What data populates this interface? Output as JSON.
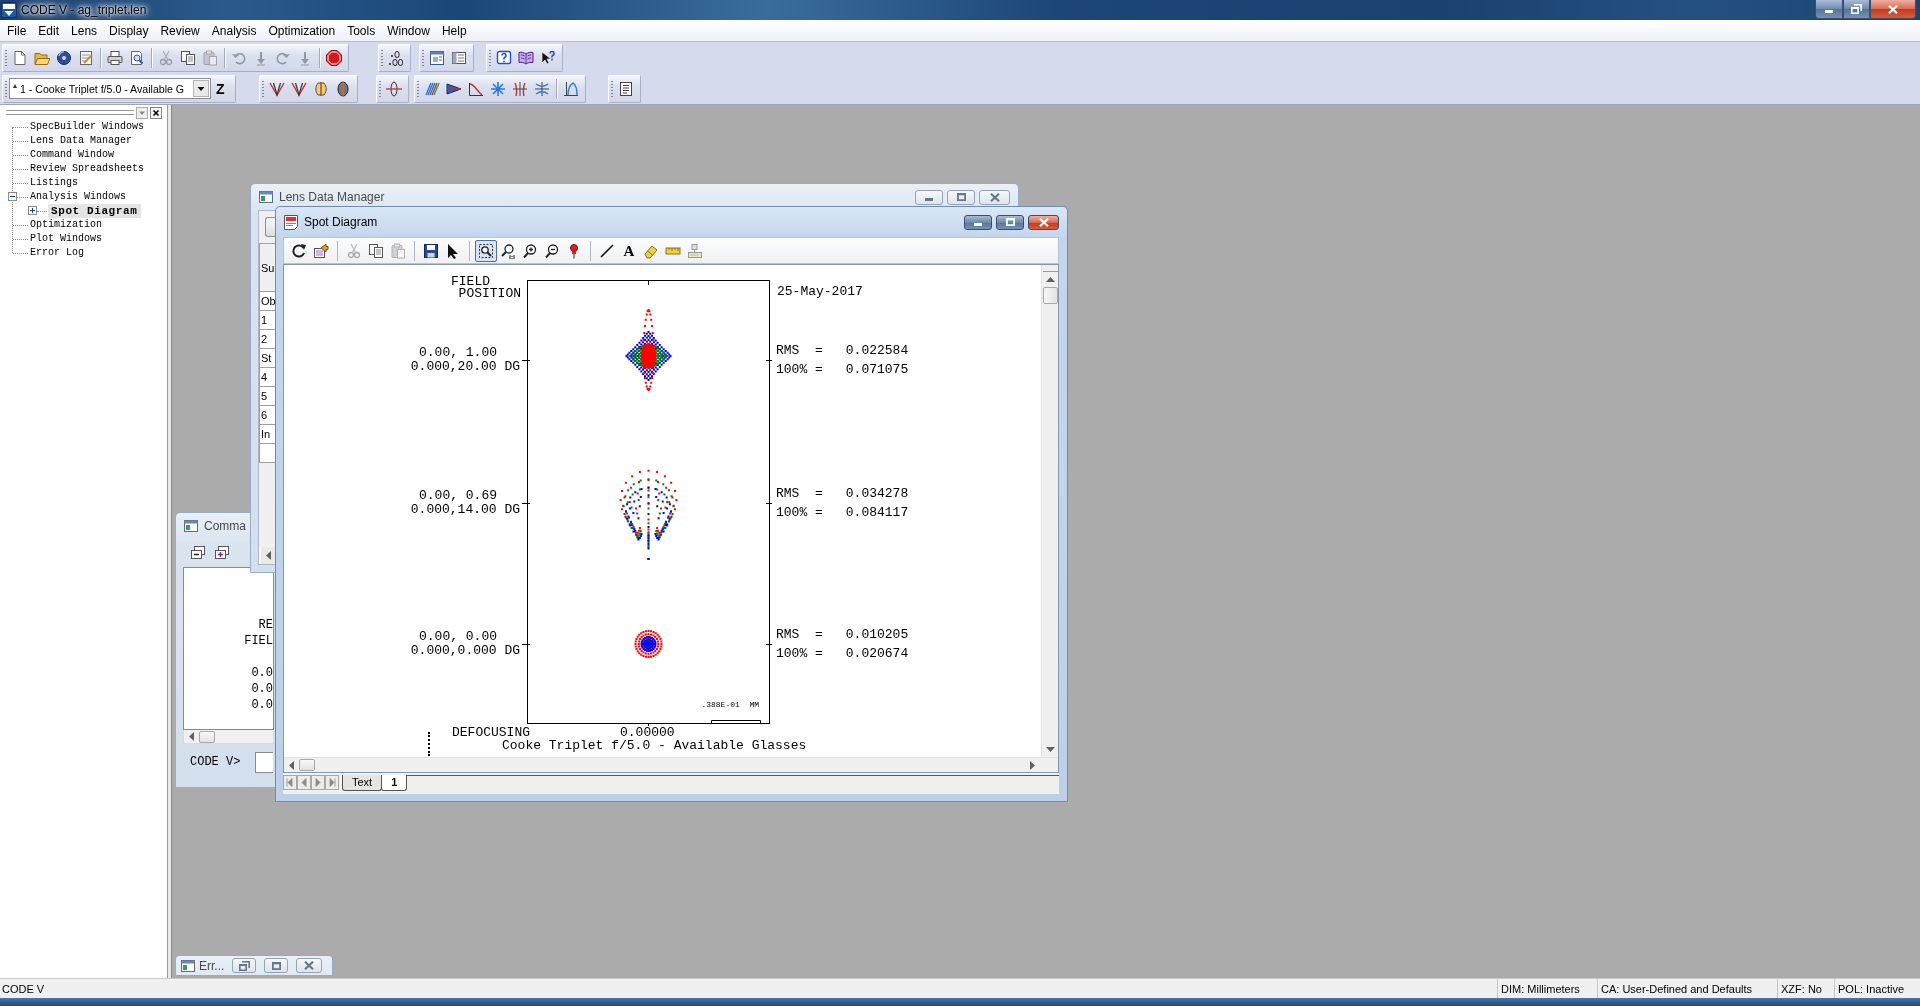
{
  "window": {
    "title": "CODE V - ag_triplet.len"
  },
  "menu": [
    "File",
    "Edit",
    "Lens",
    "Display",
    "Review",
    "Analysis",
    "Optimization",
    "Tools",
    "Window",
    "Help"
  ],
  "toolbar_1": {
    "bands": [
      [
        [
          {
            "kind": "new",
            "disabled": false
          },
          {
            "kind": "open",
            "disabled": false
          },
          {
            "kind": "disc",
            "disabled": false
          },
          {
            "kind": "edit",
            "disabled": false
          }
        ],
        [
          {
            "kind": "print",
            "disabled": false
          },
          {
            "kind": "preview",
            "disabled": false
          }
        ],
        [
          {
            "kind": "cut",
            "disabled": true
          },
          {
            "kind": "copy",
            "disabled": false
          },
          {
            "kind": "paste",
            "disabled": true
          }
        ],
        [
          {
            "kind": "undo",
            "disabled": true
          },
          {
            "kind": "down",
            "disabled": true
          },
          {
            "kind": "redo",
            "disabled": true
          },
          {
            "kind": "down",
            "disabled": true
          }
        ],
        [
          {
            "kind": "stop",
            "disabled": false
          }
        ]
      ],
      [
        [
          {
            "kind": "decimal",
            "disabled": false
          }
        ]
      ],
      [
        [
          {
            "kind": "chartwin",
            "disabled": false
          },
          {
            "kind": "panelwin",
            "disabled": false
          }
        ]
      ],
      [
        [
          {
            "kind": "help",
            "disabled": false
          },
          {
            "kind": "book",
            "disabled": false
          },
          {
            "kind": "whatsthis",
            "disabled": false
          }
        ]
      ]
    ]
  },
  "toolbar_2": {
    "lens_selector": {
      "value": "1 - Cooke Triplet f/5.0 - Available G"
    },
    "z_button": {
      "label": "Z"
    },
    "bands": [
      [
        [
          {
            "kind": "fan",
            "disabled": false
          },
          {
            "kind": "fan",
            "disabled": false
          },
          {
            "kind": "lens",
            "disabled": false
          },
          {
            "kind": "darklens",
            "disabled": false
          }
        ]
      ],
      [
        [
          {
            "kind": "axis",
            "disabled": false
          }
        ]
      ],
      [
        [
          {
            "kind": "trace",
            "disabled": false
          },
          {
            "kind": "bundle",
            "disabled": false
          },
          {
            "kind": "mtf",
            "disabled": false
          },
          {
            "kind": "star",
            "disabled": false
          },
          {
            "kind": "fieldcurve",
            "disabled": false
          },
          {
            "kind": "distortion",
            "disabled": false
          }
        ],
        [
          {
            "kind": "peak",
            "disabled": false
          }
        ]
      ],
      [
        [
          {
            "kind": "listing",
            "disabled": false
          }
        ]
      ]
    ]
  },
  "navigator": {
    "items": [
      {
        "label": "SpecBuilder Windows",
        "selected": false
      },
      {
        "label": "Lens Data Manager",
        "selected": false
      },
      {
        "label": "Command Window",
        "selected": false
      },
      {
        "label": "Review Spreadsheets",
        "selected": false
      },
      {
        "label": "Listings",
        "selected": false
      },
      {
        "label": "Analysis Windows",
        "selected": false,
        "expanded": true,
        "children": [
          {
            "label": "Spot Diagram",
            "selected": true,
            "expanded": false
          }
        ]
      },
      {
        "label": "Optimization",
        "selected": false
      },
      {
        "label": "Plot Windows",
        "selected": false
      },
      {
        "label": "Error Log",
        "selected": false
      }
    ]
  },
  "lens_data_manager": {
    "title": "Lens Data Manager",
    "header": "Su",
    "rows": [
      "Ob",
      "1",
      "2",
      "St",
      "4",
      "5",
      "6",
      "In"
    ]
  },
  "command_window": {
    "title": "Comma",
    "output": [
      [
        "RE",
        "FIEL"
      ],
      [
        "0.0",
        "0.0",
        "0.0"
      ]
    ],
    "prompt": "CODE V>"
  },
  "spot_diagram": {
    "title": "Spot Diagram",
    "toolbar": [
      [
        {
          "kind": "refresh",
          "disabled": false,
          "pressed": false
        },
        {
          "kind": "export",
          "disabled": false,
          "pressed": false
        }
      ],
      [
        {
          "kind": "cut",
          "disabled": true,
          "pressed": false
        },
        {
          "kind": "copy",
          "disabled": false,
          "pressed": false
        },
        {
          "kind": "paste",
          "disabled": true,
          "pressed": false
        }
      ],
      [
        {
          "kind": "save",
          "disabled": false,
          "pressed": false
        },
        {
          "kind": "pointer",
          "disabled": false,
          "pressed": false
        }
      ],
      [
        {
          "kind": "zoombox",
          "disabled": false,
          "pressed": true
        },
        {
          "kind": "zoom11",
          "disabled": false,
          "pressed": false
        },
        {
          "kind": "zoomin",
          "disabled": false,
          "pressed": false
        },
        {
          "kind": "zoomout",
          "disabled": false,
          "pressed": false
        },
        {
          "kind": "pin",
          "disabled": false,
          "pressed": false
        }
      ],
      [
        {
          "kind": "line",
          "disabled": false,
          "pressed": false
        },
        {
          "kind": "text",
          "label": "A",
          "disabled": false,
          "pressed": false
        },
        {
          "kind": "eraser",
          "disabled": false,
          "pressed": false
        },
        {
          "kind": "ruler",
          "disabled": false,
          "pressed": false
        },
        {
          "kind": "labeltool",
          "disabled": false,
          "pressed": false
        }
      ]
    ],
    "field_heading": [
      "FIELD",
      "POSITION"
    ],
    "date": "25-May-2017",
    "fields": [
      {
        "kind": "diamond",
        "relative": "0.00, 1.00",
        "angle": "0.000,20.00 DG",
        "rms_label": "RMS  =",
        "rms": "0.022584",
        "max_label": "100% =",
        "max": "0.071075"
      },
      {
        "kind": "fan",
        "relative": "0.00, 0.69",
        "angle": "0.000,14.00 DG",
        "rms_label": "RMS  =",
        "rms": "0.034278",
        "max_label": "100% =",
        "max": "0.084117"
      },
      {
        "kind": "disc",
        "relative": "0.00, 0.00",
        "angle": "0.000,0.000 DG",
        "rms_label": "RMS  =",
        "rms": "0.010205",
        "max_label": "100% =",
        "max": "0.020674"
      }
    ],
    "scale": ".388E-01  MM",
    "defocusing_label": "DEFOCUSING",
    "defocusing": "0.00000",
    "caption": "Cooke Triplet f/5.0 - Available Glasses",
    "tabs": [
      {
        "label": "Text",
        "selected": false
      },
      {
        "label": "1",
        "selected": true
      }
    ]
  },
  "error_log": {
    "title": "Err..."
  },
  "status_bar": {
    "text": "CODE V",
    "panes": [
      "DIM: Millimeters",
      "CA: User-Defined and Defaults",
      "XZF: No",
      "POL: Inactive"
    ]
  }
}
